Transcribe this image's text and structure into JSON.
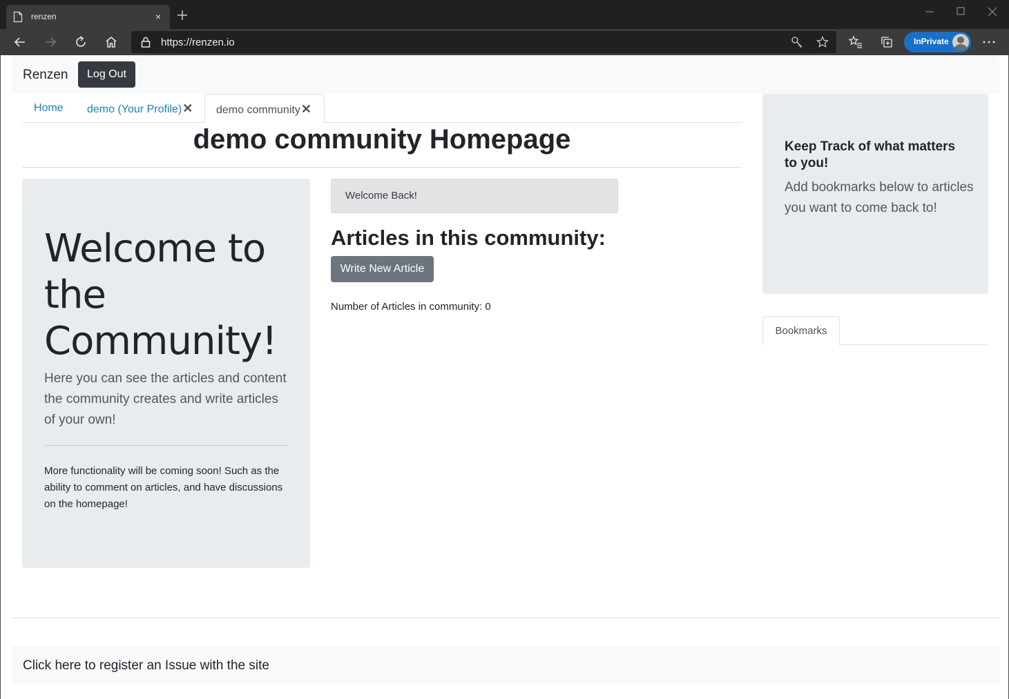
{
  "browser": {
    "tab_title": "renzen",
    "tab_close": "×",
    "url": "https://renzen.io",
    "inprivate_label": "InPrivate",
    "icons": [
      "page-icon",
      "close-icon",
      "new-tab-icon",
      "minimize-icon",
      "maximize-icon",
      "window-close-icon",
      "back-icon",
      "forward-icon",
      "refresh-icon",
      "home-icon",
      "lock-icon",
      "key-icon",
      "star-icon",
      "favorites-icon",
      "collections-icon",
      "more-icon"
    ]
  },
  "navbar": {
    "brand": "Renzen",
    "logout_label": "Log Out"
  },
  "tabs": [
    {
      "label": "Home",
      "closable": false
    },
    {
      "label": "demo (Your Profile)",
      "closable": true
    },
    {
      "label": "demo community",
      "closable": true,
      "active": true
    }
  ],
  "tab_close_glyph": "✕",
  "page_title": "demo community Homepage",
  "jumbotron": {
    "title": "Welcome to the Community!",
    "lead": "Here you can see the articles and content the community creates and write articles of your own!",
    "note": "More functionality will be coming soon! Such as the ability to comment on articles, and have discussions on the homepage!"
  },
  "main": {
    "welcome_back": "Welcome Back!",
    "articles_heading": "Articles in this community:",
    "write_button": "Write New Article",
    "article_count_text": "Number of Articles in community: 0"
  },
  "sidebar": {
    "title": "Keep Track of what matters to you!",
    "lead": "Add bookmarks below to articles you want to come back to!",
    "bookmarks_tab": "Bookmarks"
  },
  "footer": {
    "issue_link": "Click here to register an Issue with the site"
  },
  "colors": {
    "link": "#1e7fb3",
    "dark_button": "#343a40",
    "secondary_button": "#6c757d",
    "jumbotron_bg": "#e9ecef",
    "inprivate": "#1a6fc9"
  }
}
